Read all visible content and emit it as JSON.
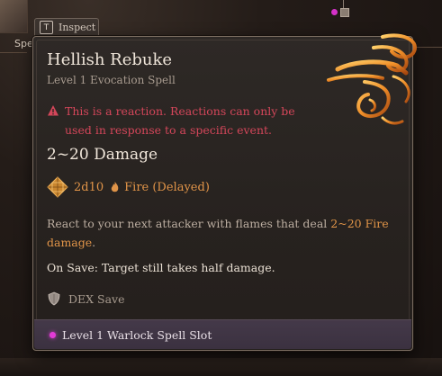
{
  "hud": {
    "left_label": "Spe"
  },
  "inspect_tab": {
    "key": "T",
    "label": "Inspect"
  },
  "spell": {
    "title": "Hellish Rebuke",
    "subtitle": "Level 1 Evocation Spell",
    "reaction_warning": "This is a reaction. Reactions can only be used in response to a specific event.",
    "damage_heading": "2~20 Damage",
    "dice": {
      "value": "2d10",
      "type": "Fire (Delayed)",
      "icon": "d10-icon",
      "element_icon": "flame-icon"
    },
    "description": {
      "before": "React to your next attacker with flames that deal ",
      "highlight": "2~20 Fire damage",
      "after": "."
    },
    "on_save": "On Save: Target still takes half damage.",
    "save": {
      "label": "DEX Save",
      "icon": "shield-icon"
    },
    "spell_slot": {
      "label": "Level 1 Warlock Spell Slot",
      "color": "#e23bd6"
    }
  },
  "colors": {
    "warning": "#d4465a",
    "accent_orange": "#e09448",
    "title": "#f0e6da",
    "panel": "#2e2926",
    "footer": "#443949"
  }
}
